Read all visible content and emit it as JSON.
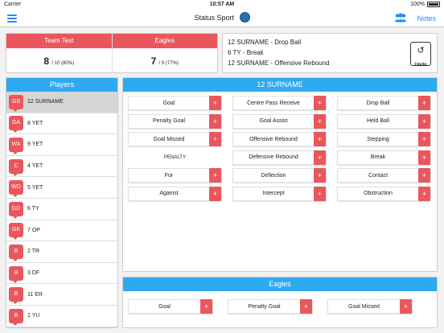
{
  "status_bar": {
    "carrier": "Carrier",
    "time": "10:57 AM",
    "battery": "100%"
  },
  "nav": {
    "title": "Status Sport",
    "notes_label": "Notes",
    "menu_icon": "hamburger-icon",
    "team_icon": "people-icon"
  },
  "scoreboard": {
    "teams": [
      {
        "name": "Team Test",
        "score": "8",
        "detail": "/ 10 (80%)"
      },
      {
        "name": "Eagles",
        "score": "7",
        "detail": "/ 9 (77%)"
      }
    ],
    "header_color": "#e9575d"
  },
  "log": {
    "lines": [
      "12 SURNAME - Drop Ball",
      "6 TY - Break",
      "12 SURNAME - Offensive Rebound"
    ],
    "undo_label": "Undo"
  },
  "players": {
    "title": "Players",
    "items": [
      {
        "pos": "GS",
        "name": "12 SURNAME"
      },
      {
        "pos": "GA",
        "name": "8 YET"
      },
      {
        "pos": "WA",
        "name": "9 YET"
      },
      {
        "pos": "C",
        "name": "4 YET"
      },
      {
        "pos": "WD",
        "name": "5 YET"
      },
      {
        "pos": "GD",
        "name": "6 TY"
      },
      {
        "pos": "GK",
        "name": "7 OP"
      },
      {
        "pos": "B",
        "name": "2 TR"
      },
      {
        "pos": "B",
        "name": "3 DF"
      },
      {
        "pos": "B",
        "name": "11 ER"
      },
      {
        "pos": "B",
        "name": "1 YU"
      }
    ]
  },
  "actions": {
    "title": "12 SURNAME",
    "rows": [
      [
        "Goal",
        "Centre Pass Receive",
        "Drop Ball"
      ],
      [
        "Penalty Goal",
        "Goal Assist",
        "Held Ball"
      ],
      [
        "Goal Missed",
        "Offensive Rebound",
        "Stepping"
      ],
      [
        "PENALTY",
        "Defensive Rebound",
        "Break"
      ],
      [
        "For",
        "Deflection",
        "Contact"
      ],
      [
        "Against",
        "Intercept",
        "Obstruction"
      ]
    ],
    "plus": "+"
  },
  "team_actions": {
    "title": "Eagles",
    "items": [
      "Goal",
      "Penalty Goal",
      "Goal Missed"
    ]
  },
  "colors": {
    "accent_blue": "#2eaaf1",
    "link_blue": "#1a8cff",
    "red": "#e9575d"
  }
}
